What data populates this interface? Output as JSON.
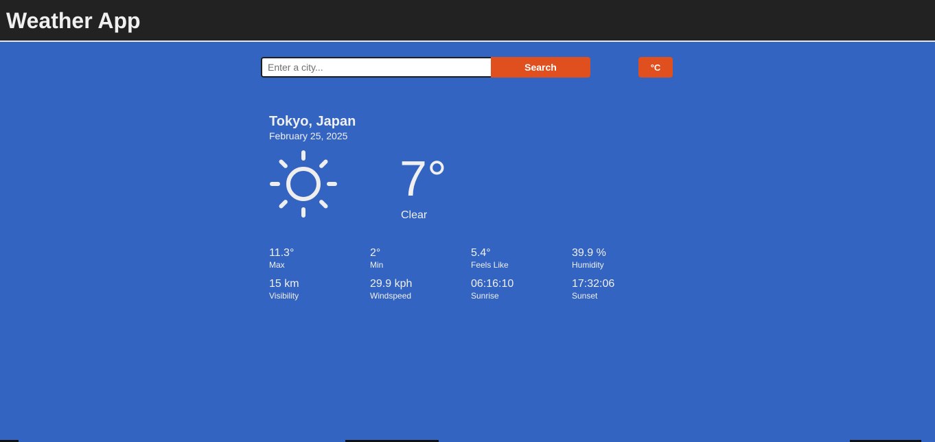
{
  "header": {
    "title": "Weather App"
  },
  "search": {
    "placeholder": "Enter a city...",
    "value": "",
    "button_label": "Search"
  },
  "unit_toggle": {
    "label": "°C"
  },
  "location": {
    "city": "Tokyo, Japan",
    "date": "February 25, 2025"
  },
  "current": {
    "icon": "sun-icon",
    "temperature": "7°",
    "condition": "Clear"
  },
  "stats": [
    {
      "value": "11.3°",
      "label": "Max"
    },
    {
      "value": "2°",
      "label": "Min"
    },
    {
      "value": "5.4°",
      "label": "Feels Like"
    },
    {
      "value": "39.9 %",
      "label": "Humidity"
    },
    {
      "value": "15 km",
      "label": "Visibility"
    },
    {
      "value": "29.9 kph",
      "label": "Windspeed"
    },
    {
      "value": "06:16:10",
      "label": "Sunrise"
    },
    {
      "value": "17:32:06",
      "label": "Sunset"
    }
  ],
  "colors": {
    "header": "#222222",
    "background": "#3464c1",
    "accent": "#e0501e",
    "text": "#f0f0f0"
  }
}
